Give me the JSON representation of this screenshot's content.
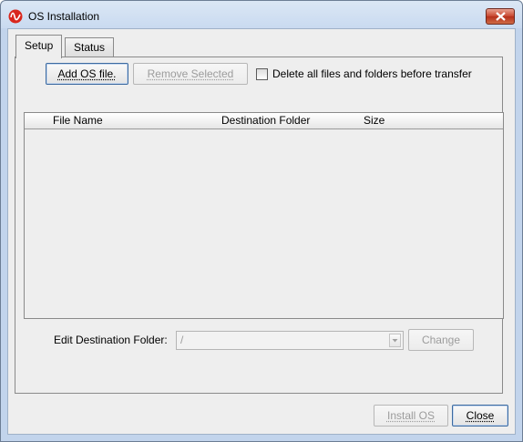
{
  "window": {
    "title": "OS Installation",
    "title_icon": "ti-logo-icon",
    "accent_close": "#c7452e"
  },
  "tabs": [
    {
      "label": "Setup",
      "selected": true
    },
    {
      "label": "Status",
      "selected": false
    }
  ],
  "setup": {
    "add_button": "Add OS file.",
    "remove_button": "Remove Selected",
    "delete_checkbox_label": "Delete all files and folders before transfer",
    "delete_checked": false,
    "table": {
      "columns": [
        "File Name",
        "Destination Folder",
        "Size"
      ],
      "rows": []
    },
    "edit_folder_label": "Edit Destination Folder:",
    "folder_value": "/",
    "change_button": "Change"
  },
  "footer": {
    "install_button": "Install OS",
    "close_button": "Close"
  }
}
